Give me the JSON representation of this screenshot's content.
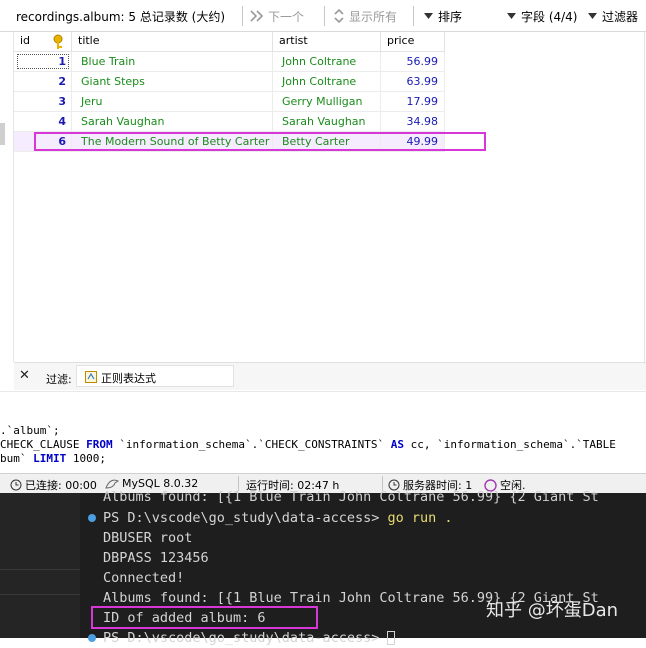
{
  "toolbar": {
    "title": "recordings.album: 5 总记录数 (大约)",
    "next_label": "下一个",
    "show_all_label": "显示所有",
    "sort_label": "排序",
    "fields_label": "字段 (4/4)",
    "filter_label": "过滤器"
  },
  "grid": {
    "columns": [
      "id",
      "title",
      "artist",
      "price"
    ],
    "rows": [
      {
        "id": "1",
        "title": "Blue Train",
        "artist": "John Coltrane",
        "price": "56.99"
      },
      {
        "id": "2",
        "title": "Giant Steps",
        "artist": "John Coltrane",
        "price": "63.99"
      },
      {
        "id": "3",
        "title": "Jeru",
        "artist": "Gerry Mulligan",
        "price": "17.99"
      },
      {
        "id": "4",
        "title": "Sarah Vaughan",
        "artist": "Sarah Vaughan",
        "price": "34.98"
      },
      {
        "id": "6",
        "title": "The Modern Sound of Betty Carter",
        "artist": "Betty Carter",
        "price": "49.99"
      }
    ],
    "colors": {
      "id": "#1a1ab2",
      "text": "#1a8c1a",
      "highlight": "#d637d6"
    }
  },
  "filterbar": {
    "close": "✕",
    "label": "过滤:",
    "regex_label": "正则表达式"
  },
  "sql": {
    "line1": ".`album`;",
    "line2_a": "CHECK_CLAUSE ",
    "line2_from": "FROM",
    "line2_b": " `information_schema`.`CHECK_CONSTRAINTS` ",
    "line2_as": "AS",
    "line2_c": " cc, `information_schema`.`TABLE",
    "line3_a": "bum` ",
    "line3_limit": "LIMIT",
    "line3_b": " 1000;"
  },
  "status": {
    "connected": "已连接: 00:00",
    "server": "MySQL 8.0.32",
    "runtime": "运行时间: 02:47 h",
    "server_time": "服务器时间: 1",
    "idle": "空闲."
  },
  "terminal": {
    "lines": [
      "Albums found: [{1 Blue Train John Coltrane 56.99} {2 Giant St",
      "PS D:\\vscode\\go_study\\data-access> go run .",
      "DBUSER root",
      "DBPASS 123456",
      "Connected!",
      "Albums found: [{1 Blue Train John Coltrane 56.99} {2 Giant St",
      "ID of added album: 6",
      "PS D:\\vscode\\go_study\\data-access> "
    ],
    "prompt_path": "PS D:\\vscode\\go_study\\data-access> ",
    "prompt_cmd": "go run ."
  },
  "watermark": "知乎 @坏蛋Dan"
}
